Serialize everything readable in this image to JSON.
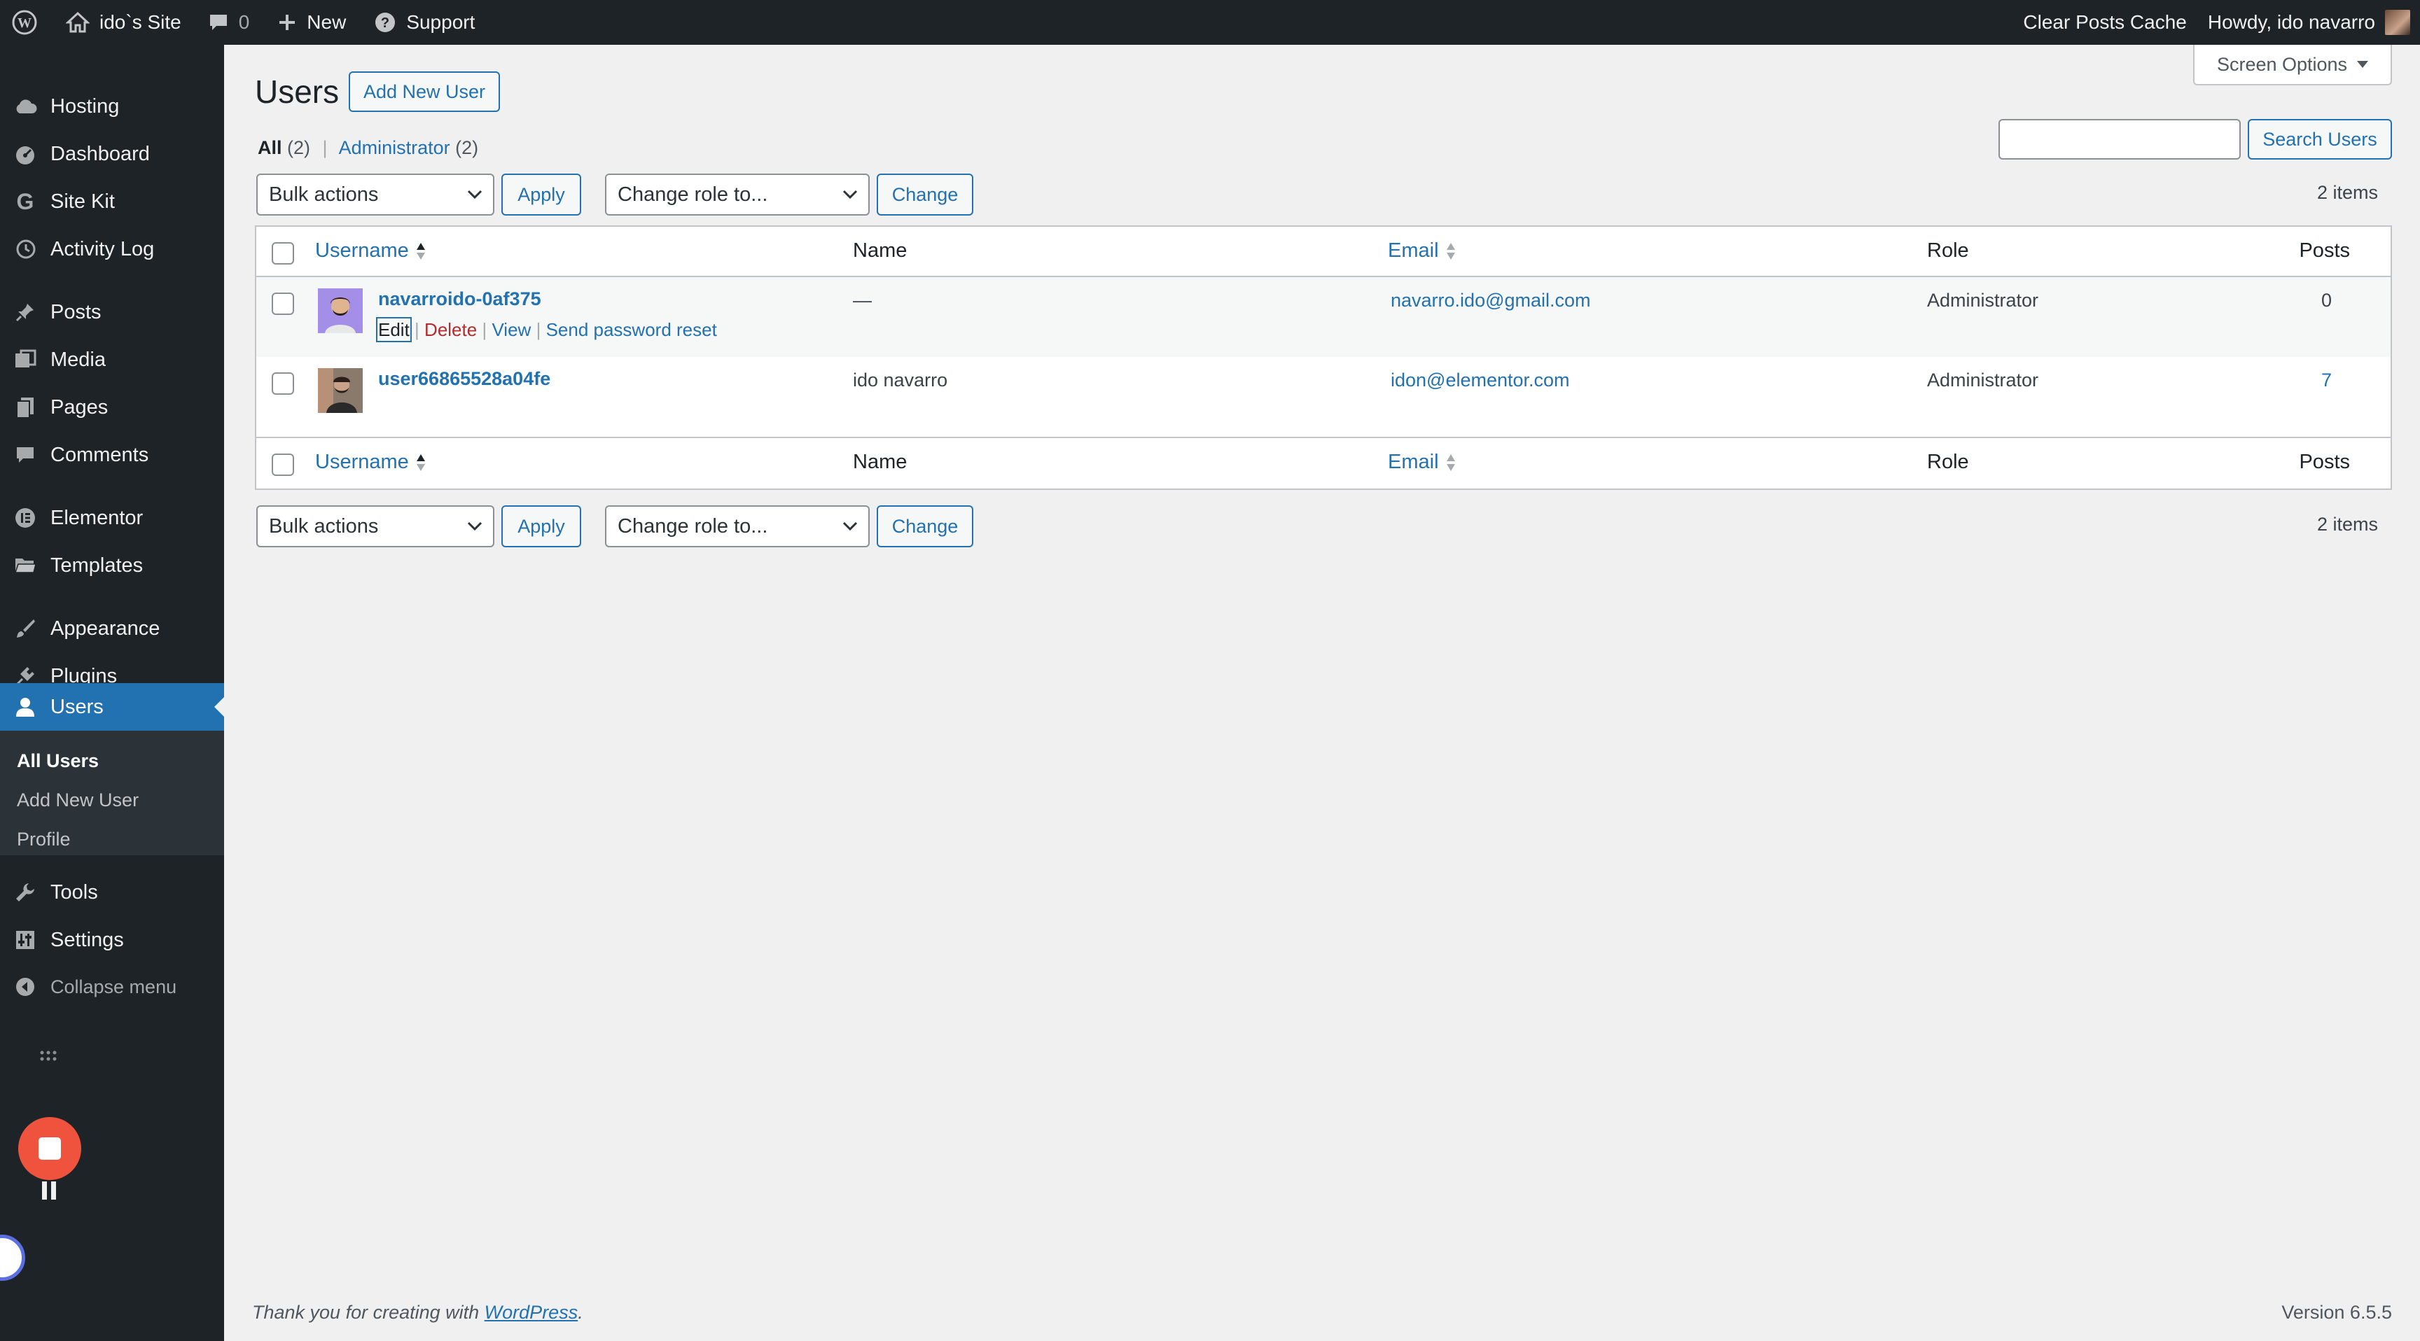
{
  "adminbar": {
    "site_name": "ido`s Site",
    "comments_count": "0",
    "new_label": "New",
    "support_label": "Support",
    "clear_cache_label": "Clear Posts Cache",
    "howdy_label": "Howdy, ido navarro"
  },
  "sidebar": {
    "items": [
      {
        "label": "Hosting",
        "icon": "cloud-icon"
      },
      {
        "label": "Dashboard",
        "icon": "dashboard-icon"
      },
      {
        "label": "Site Kit",
        "icon": "google-g-icon"
      },
      {
        "label": "Activity Log",
        "icon": "history-icon"
      },
      {
        "label": "Posts",
        "icon": "pin-icon"
      },
      {
        "label": "Media",
        "icon": "media-icon"
      },
      {
        "label": "Pages",
        "icon": "pages-icon"
      },
      {
        "label": "Comments",
        "icon": "comment-icon"
      },
      {
        "label": "Elementor",
        "icon": "elementor-icon"
      },
      {
        "label": "Templates",
        "icon": "folder-icon"
      },
      {
        "label": "Appearance",
        "icon": "brush-icon"
      },
      {
        "label": "Plugins",
        "icon": "plug-icon"
      },
      {
        "label": "Users",
        "icon": "user-icon"
      },
      {
        "label": "Tools",
        "icon": "wrench-icon"
      },
      {
        "label": "Settings",
        "icon": "settings-icon"
      },
      {
        "label": "Collapse menu",
        "icon": "collapse-icon"
      }
    ],
    "submenu": [
      "All Users",
      "Add New User",
      "Profile"
    ]
  },
  "page": {
    "title": "Users",
    "add_new_label": "Add New User",
    "screen_options_label": "Screen Options",
    "search_button_label": "Search Users",
    "search_value": "",
    "filter_all": "All",
    "filter_all_count": "(2)",
    "filter_sep": "|",
    "filter_admin": "Administrator",
    "filter_admin_count": "(2)",
    "bulk_actions": "Bulk actions",
    "apply_label": "Apply",
    "change_role": "Change role to...",
    "change_label": "Change",
    "items_count": "2 items"
  },
  "table": {
    "columns": {
      "username": "Username",
      "name": "Name",
      "email": "Email",
      "role": "Role",
      "posts": "Posts"
    },
    "rows": [
      {
        "username": "navarroido-0af375",
        "name": "—",
        "email": "navarro.ido@gmail.com",
        "role": "Administrator",
        "posts": "0"
      },
      {
        "username": "user66865528a04fe",
        "name": "ido navarro",
        "email": "idon@elementor.com",
        "role": "Administrator",
        "posts": "7"
      }
    ],
    "row_actions": {
      "edit": "Edit",
      "delete": "Delete",
      "view": "View",
      "reset": "Send password reset",
      "sep": "|"
    }
  },
  "footer": {
    "thanks_prefix": "Thank you for creating with ",
    "wordpress_link": "WordPress",
    "thanks_suffix": ".",
    "version": "Version 6.5.5"
  },
  "colors": {
    "accent": "#2271b1",
    "adminbar_bg": "#1d2327",
    "delete": "#b32d2e",
    "record": "#f0533d"
  }
}
